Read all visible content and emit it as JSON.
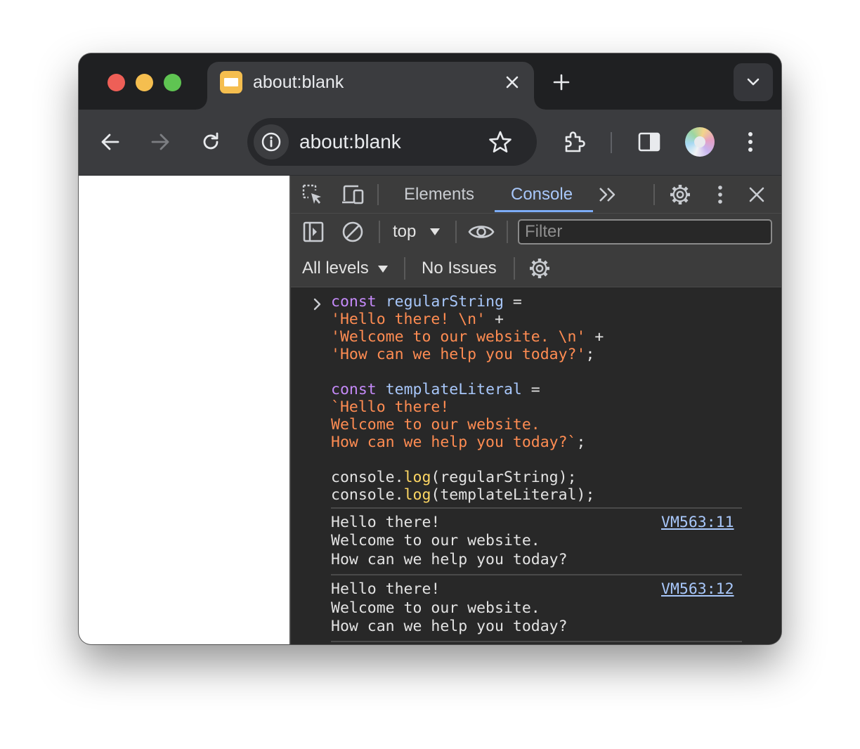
{
  "tab": {
    "title": "about:blank"
  },
  "omnibox": {
    "url": "about:blank"
  },
  "devtools": {
    "tabs": [
      {
        "label": "Elements"
      },
      {
        "label": "Console"
      }
    ],
    "console_toolbar": {
      "context": "top",
      "filter_placeholder": "Filter",
      "levels": "All levels",
      "issues": "No Issues"
    }
  },
  "console": {
    "code": {
      "l1_kw": "const",
      "l1_var": "regularString",
      "l1_op": " =",
      "l2_str": "'Hello there! \\n'",
      "l2_op": " +",
      "l3_str": "'Welcome to our website. \\n'",
      "l3_op": " +",
      "l4_str": "'How can we help you today?'",
      "l4_op": ";",
      "l5_kw": "const",
      "l5_var": "templateLiteral",
      "l5_op": " =",
      "l6_str": "`Hello there!",
      "l7_str": "Welcome to our website.",
      "l8_str": "How can we help you today?`",
      "l8_op": ";",
      "l9_obj": "console.",
      "l9_fn": "log",
      "l9_args": "(regularString);",
      "l10_obj": "console.",
      "l10_fn": "log",
      "l10_args": "(templateLiteral);"
    },
    "outputs": [
      {
        "lines": [
          "Hello there!",
          "Welcome to our website.",
          "How can we help you today?"
        ],
        "source": "VM563:11"
      },
      {
        "lines": [
          "Hello there!",
          "Welcome to our website.",
          "How can we help you today?"
        ],
        "source": "VM563:12"
      }
    ]
  }
}
